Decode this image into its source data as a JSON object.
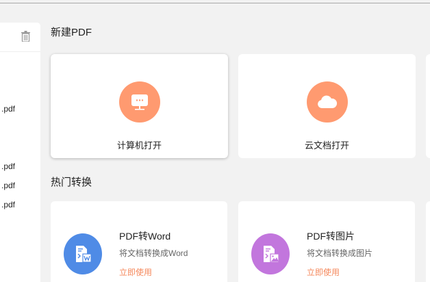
{
  "sidebar": {
    "files": [
      ".pdf",
      ".pdf",
      ".pdf",
      ".pdf"
    ]
  },
  "new_pdf": {
    "title": "新建PDF",
    "cards": [
      {
        "label": "计算机打开",
        "icon": "computer-icon",
        "color": "#ff9a70"
      },
      {
        "label": "云文档打开",
        "icon": "cloud-icon",
        "color": "#ff9a70"
      }
    ]
  },
  "hot": {
    "title": "热门转换",
    "cards": [
      {
        "title": "PDF转Word",
        "desc": "将文档转换成Word",
        "action": "立即使用",
        "icon": "pdf-to-word-icon",
        "color": "#4f8be6"
      },
      {
        "title": "PDF转图片",
        "desc": "将文档转换成图片",
        "action": "立即使用",
        "icon": "pdf-to-image-icon",
        "color": "#c276dd"
      }
    ]
  },
  "accent": "#f5895d"
}
